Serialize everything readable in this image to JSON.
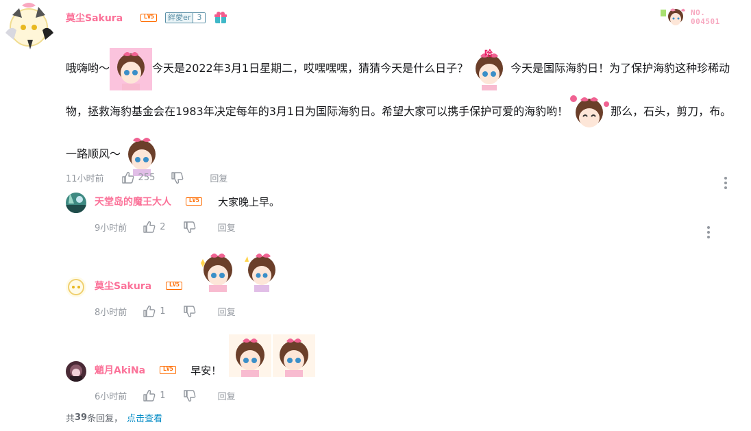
{
  "root": {
    "username": "莫尘Sakura",
    "level": "LV5",
    "fan_badge": {
      "name": "絆愛er",
      "level": "3"
    },
    "number_badge": {
      "line1": "NO.",
      "line2": "004501"
    },
    "content": {
      "seg1": "哦嗨哟～",
      "seg2": "今天是2022年3月1日星期二，哎嘿嘿嘿，猜猜今天是什么日子？",
      "seg3": "今天是国际海豹日！为了保护海豹这种珍稀动物，拯救海豹基金会在1983年决定每年的3月1日为国际海豹日。希望大家可以携手保护可爱的海豹哟！",
      "seg4": "那么，石头，剪刀，布。一路顺风～"
    },
    "time": "11小时前",
    "likes": "255",
    "reply_label": "回复"
  },
  "replies": [
    {
      "username": "天堂岛的魔王大人",
      "level": "LV5",
      "text": "大家晚上早。",
      "time": "9小时前",
      "likes": "2",
      "reply_label": "回复"
    },
    {
      "username": "莫尘Sakura",
      "level": "LV5",
      "text": "",
      "time": "8小时前",
      "likes": "1",
      "reply_label": "回复"
    },
    {
      "username": "魈月AkiNa",
      "level": "LV5",
      "text": "早安！",
      "time": "6小时前",
      "likes": "1",
      "reply_label": "回复"
    }
  ],
  "footer": {
    "prefix": "共",
    "count": "39",
    "suffix": "条回复，",
    "link": "点击查看"
  },
  "colors": {
    "username": "#fb7299",
    "level": "#ff6c00",
    "link": "#008ac5",
    "meta": "#9499a0"
  },
  "icons": [
    "thumb-up-icon",
    "thumb-down-icon",
    "more-vertical-icon",
    "gift-badge-icon"
  ]
}
